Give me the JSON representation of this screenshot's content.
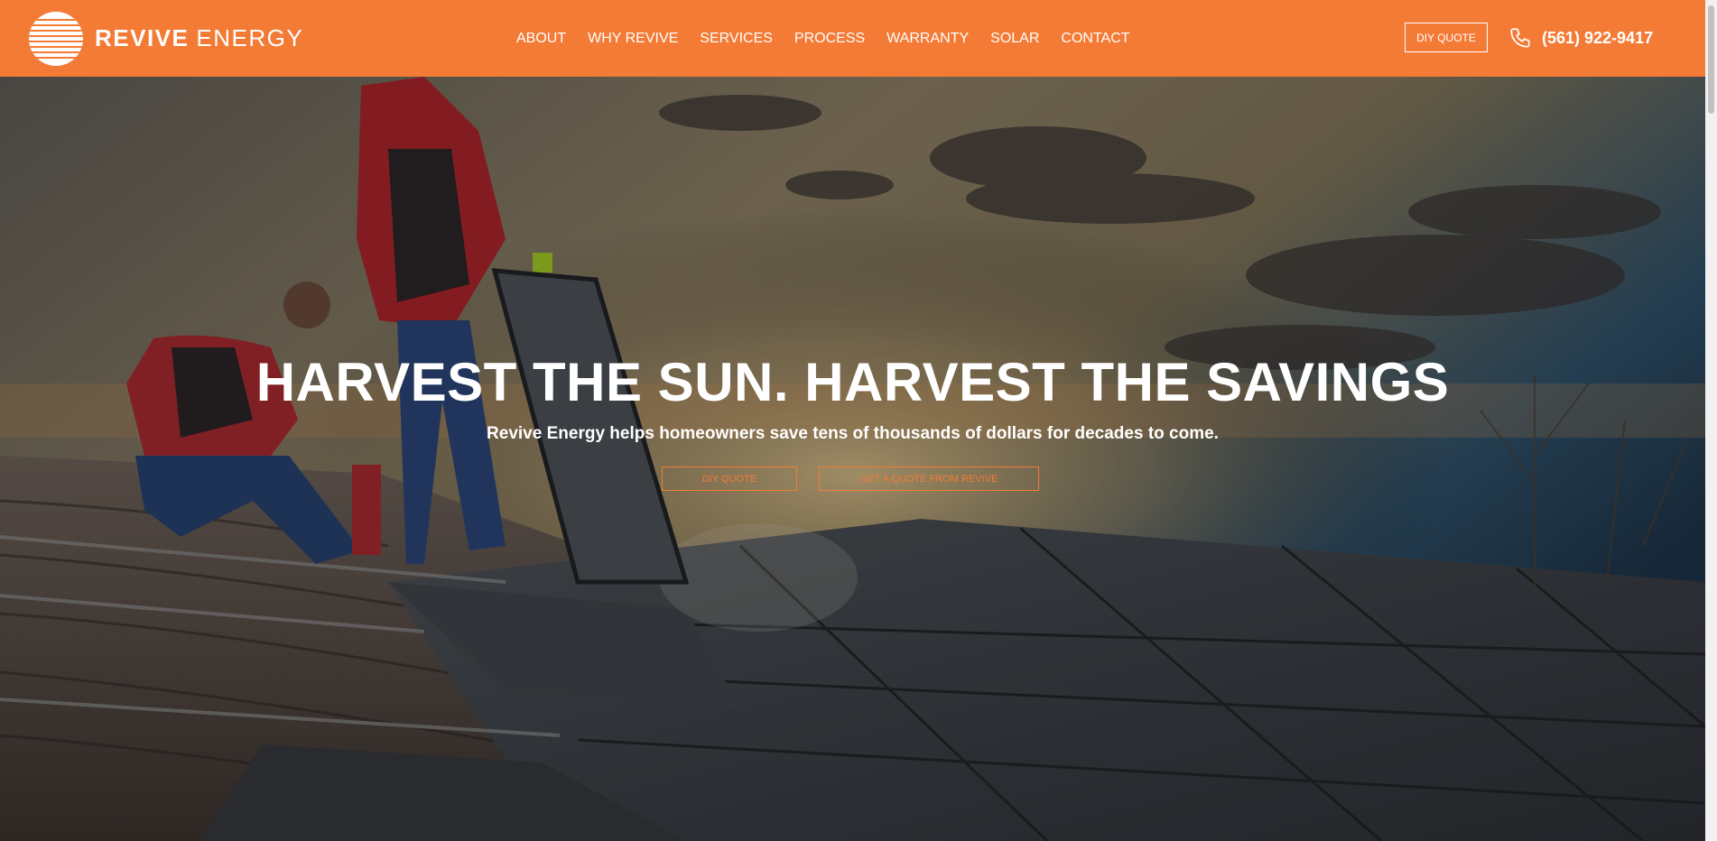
{
  "brand": {
    "name_strong": "REVIVE",
    "name_light": "ENERGY",
    "accent": "#f47b36"
  },
  "nav": {
    "items": [
      {
        "label": "ABOUT"
      },
      {
        "label": "WHY REVIVE"
      },
      {
        "label": "SERVICES"
      },
      {
        "label": "PROCESS"
      },
      {
        "label": "WARRANTY"
      },
      {
        "label": "SOLAR"
      },
      {
        "label": "CONTACT"
      }
    ]
  },
  "header": {
    "diy_quote_label": "DIY QUOTE",
    "phone_icon": "phone-icon",
    "phone": "(561) 922-9417"
  },
  "hero": {
    "title": "HARVEST THE SUN. HARVEST THE SAVINGS",
    "subtitle": "Revive Energy helps homeowners save tens of thousands of dollars for decades to come.",
    "cta_primary": "DIY QUOTE",
    "cta_secondary": "GET A QUOTE FROM REVIVE"
  }
}
